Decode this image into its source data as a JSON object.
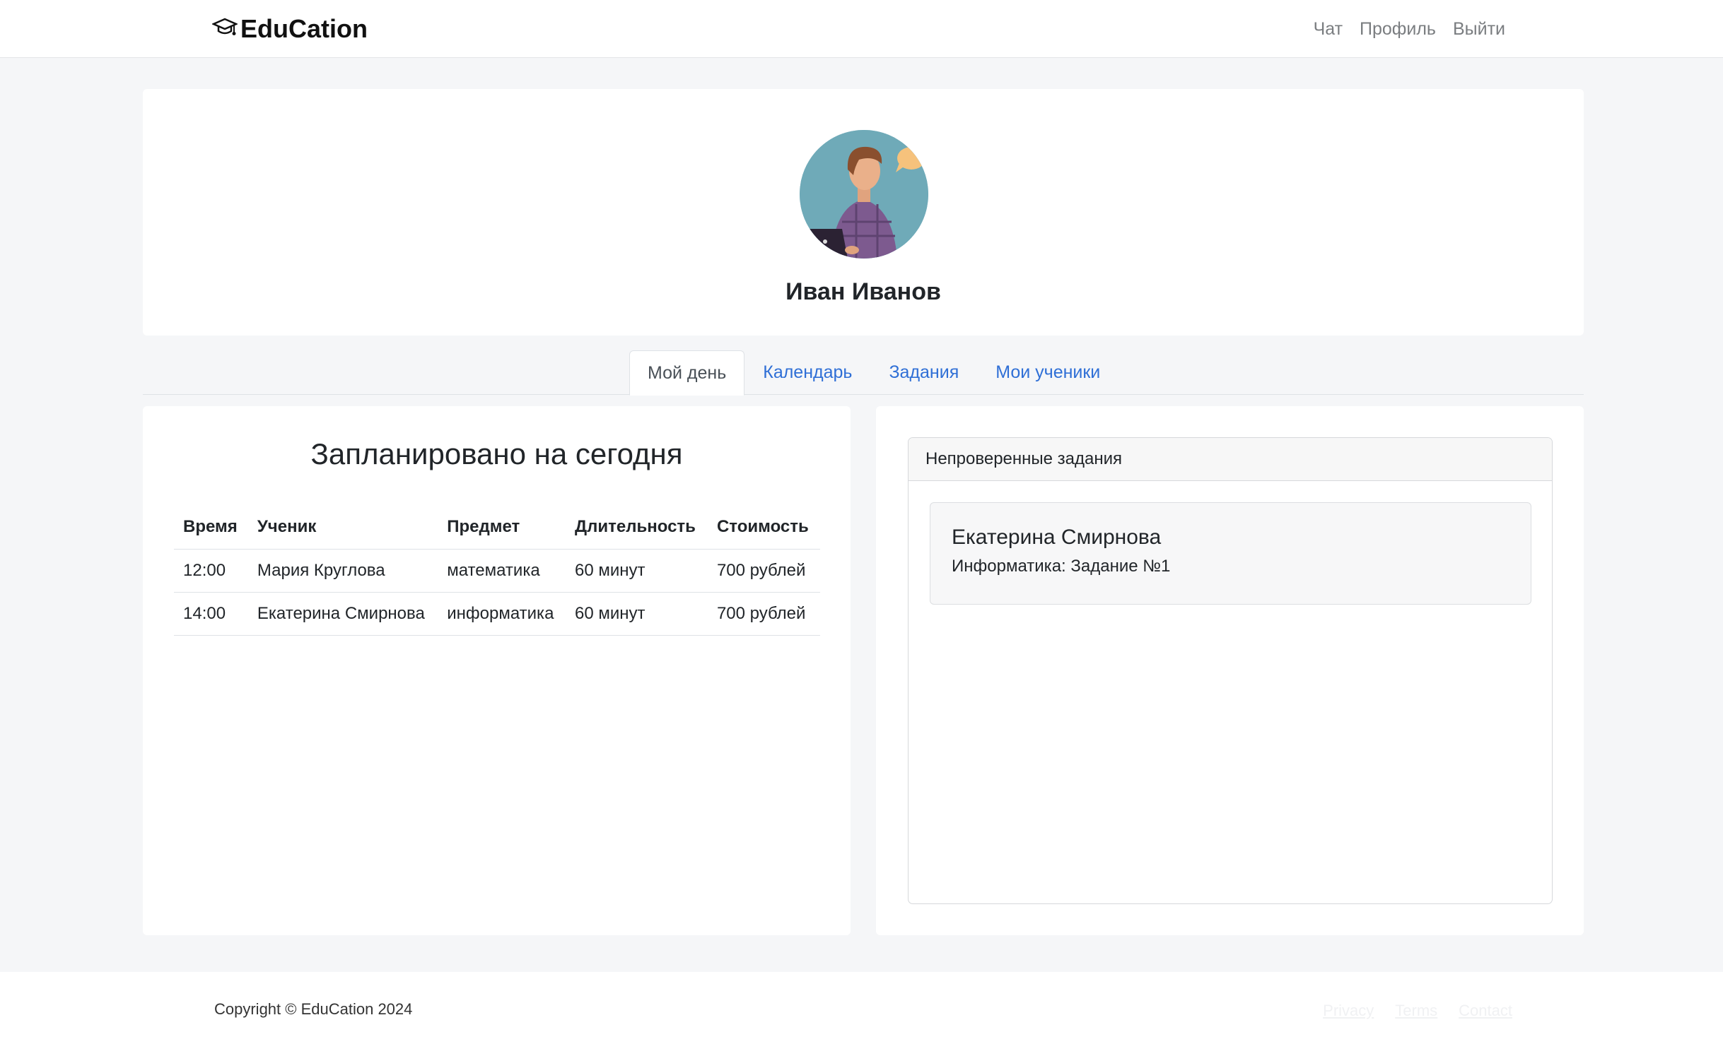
{
  "navbar": {
    "brand": "EduCation",
    "brand_icon": "graduation-cap-icon",
    "links": [
      "Чат",
      "Профиль",
      "Выйти"
    ]
  },
  "profile": {
    "name": "Иван Иванов",
    "avatar_icon": "user-illustration"
  },
  "tabs": [
    {
      "label": "Мой день",
      "active": true
    },
    {
      "label": "Календарь",
      "active": false
    },
    {
      "label": "Задания",
      "active": false
    },
    {
      "label": "Мои ученики",
      "active": false
    }
  ],
  "schedule": {
    "title": "Запланировано на сегодня",
    "columns": [
      "Время",
      "Ученик",
      "Предмет",
      "Длительность",
      "Стоимость"
    ],
    "rows": [
      [
        "12:00",
        "Мария Круглова",
        "математика",
        "60 минут",
        "700 рублей"
      ],
      [
        "14:00",
        "Екатерина Смирнова",
        "информатика",
        "60 минут",
        "700 рублей"
      ]
    ]
  },
  "unchecked_tasks": {
    "header": "Непроверенные задания",
    "items": [
      {
        "student": "Екатерина Смирнова",
        "subject": "Информатика: Задание №1"
      }
    ]
  },
  "footer": {
    "copyright": "Copyright © EduCation 2024",
    "links": [
      "Privacy",
      "Terms",
      "Contact"
    ]
  },
  "colors": {
    "accent": "#2f6fd6",
    "page_bg": "#f5f6f8",
    "avatar_bg": "#6faab8"
  }
}
